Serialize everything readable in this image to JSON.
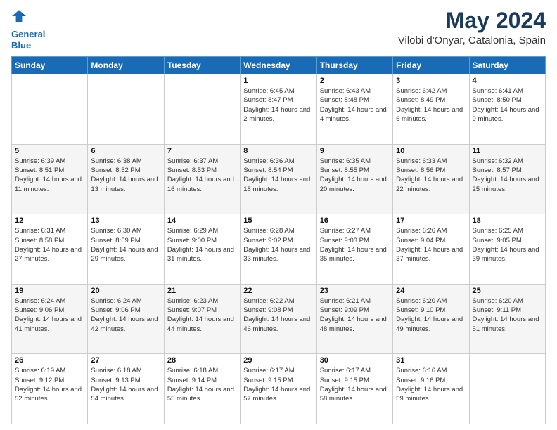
{
  "logo": {
    "line1": "General",
    "line2": "Blue"
  },
  "title": "May 2024",
  "subtitle": "Vilobi d'Onyar, Catalonia, Spain",
  "weekdays": [
    "Sunday",
    "Monday",
    "Tuesday",
    "Wednesday",
    "Thursday",
    "Friday",
    "Saturday"
  ],
  "weeks": [
    [
      {
        "day": "",
        "sunrise": "",
        "sunset": "",
        "daylight": ""
      },
      {
        "day": "",
        "sunrise": "",
        "sunset": "",
        "daylight": ""
      },
      {
        "day": "",
        "sunrise": "",
        "sunset": "",
        "daylight": ""
      },
      {
        "day": "1",
        "sunrise": "Sunrise: 6:45 AM",
        "sunset": "Sunset: 8:47 PM",
        "daylight": "Daylight: 14 hours and 2 minutes."
      },
      {
        "day": "2",
        "sunrise": "Sunrise: 6:43 AM",
        "sunset": "Sunset: 8:48 PM",
        "daylight": "Daylight: 14 hours and 4 minutes."
      },
      {
        "day": "3",
        "sunrise": "Sunrise: 6:42 AM",
        "sunset": "Sunset: 8:49 PM",
        "daylight": "Daylight: 14 hours and 6 minutes."
      },
      {
        "day": "4",
        "sunrise": "Sunrise: 6:41 AM",
        "sunset": "Sunset: 8:50 PM",
        "daylight": "Daylight: 14 hours and 9 minutes."
      }
    ],
    [
      {
        "day": "5",
        "sunrise": "Sunrise: 6:39 AM",
        "sunset": "Sunset: 8:51 PM",
        "daylight": "Daylight: 14 hours and 11 minutes."
      },
      {
        "day": "6",
        "sunrise": "Sunrise: 6:38 AM",
        "sunset": "Sunset: 8:52 PM",
        "daylight": "Daylight: 14 hours and 13 minutes."
      },
      {
        "day": "7",
        "sunrise": "Sunrise: 6:37 AM",
        "sunset": "Sunset: 8:53 PM",
        "daylight": "Daylight: 14 hours and 16 minutes."
      },
      {
        "day": "8",
        "sunrise": "Sunrise: 6:36 AM",
        "sunset": "Sunset: 8:54 PM",
        "daylight": "Daylight: 14 hours and 18 minutes."
      },
      {
        "day": "9",
        "sunrise": "Sunrise: 6:35 AM",
        "sunset": "Sunset: 8:55 PM",
        "daylight": "Daylight: 14 hours and 20 minutes."
      },
      {
        "day": "10",
        "sunrise": "Sunrise: 6:33 AM",
        "sunset": "Sunset: 8:56 PM",
        "daylight": "Daylight: 14 hours and 22 minutes."
      },
      {
        "day": "11",
        "sunrise": "Sunrise: 6:32 AM",
        "sunset": "Sunset: 8:57 PM",
        "daylight": "Daylight: 14 hours and 25 minutes."
      }
    ],
    [
      {
        "day": "12",
        "sunrise": "Sunrise: 6:31 AM",
        "sunset": "Sunset: 8:58 PM",
        "daylight": "Daylight: 14 hours and 27 minutes."
      },
      {
        "day": "13",
        "sunrise": "Sunrise: 6:30 AM",
        "sunset": "Sunset: 8:59 PM",
        "daylight": "Daylight: 14 hours and 29 minutes."
      },
      {
        "day": "14",
        "sunrise": "Sunrise: 6:29 AM",
        "sunset": "Sunset: 9:00 PM",
        "daylight": "Daylight: 14 hours and 31 minutes."
      },
      {
        "day": "15",
        "sunrise": "Sunrise: 6:28 AM",
        "sunset": "Sunset: 9:02 PM",
        "daylight": "Daylight: 14 hours and 33 minutes."
      },
      {
        "day": "16",
        "sunrise": "Sunrise: 6:27 AM",
        "sunset": "Sunset: 9:03 PM",
        "daylight": "Daylight: 14 hours and 35 minutes."
      },
      {
        "day": "17",
        "sunrise": "Sunrise: 6:26 AM",
        "sunset": "Sunset: 9:04 PM",
        "daylight": "Daylight: 14 hours and 37 minutes."
      },
      {
        "day": "18",
        "sunrise": "Sunrise: 6:25 AM",
        "sunset": "Sunset: 9:05 PM",
        "daylight": "Daylight: 14 hours and 39 minutes."
      }
    ],
    [
      {
        "day": "19",
        "sunrise": "Sunrise: 6:24 AM",
        "sunset": "Sunset: 9:06 PM",
        "daylight": "Daylight: 14 hours and 41 minutes."
      },
      {
        "day": "20",
        "sunrise": "Sunrise: 6:24 AM",
        "sunset": "Sunset: 9:06 PM",
        "daylight": "Daylight: 14 hours and 42 minutes."
      },
      {
        "day": "21",
        "sunrise": "Sunrise: 6:23 AM",
        "sunset": "Sunset: 9:07 PM",
        "daylight": "Daylight: 14 hours and 44 minutes."
      },
      {
        "day": "22",
        "sunrise": "Sunrise: 6:22 AM",
        "sunset": "Sunset: 9:08 PM",
        "daylight": "Daylight: 14 hours and 46 minutes."
      },
      {
        "day": "23",
        "sunrise": "Sunrise: 6:21 AM",
        "sunset": "Sunset: 9:09 PM",
        "daylight": "Daylight: 14 hours and 48 minutes."
      },
      {
        "day": "24",
        "sunrise": "Sunrise: 6:20 AM",
        "sunset": "Sunset: 9:10 PM",
        "daylight": "Daylight: 14 hours and 49 minutes."
      },
      {
        "day": "25",
        "sunrise": "Sunrise: 6:20 AM",
        "sunset": "Sunset: 9:11 PM",
        "daylight": "Daylight: 14 hours and 51 minutes."
      }
    ],
    [
      {
        "day": "26",
        "sunrise": "Sunrise: 6:19 AM",
        "sunset": "Sunset: 9:12 PM",
        "daylight": "Daylight: 14 hours and 52 minutes."
      },
      {
        "day": "27",
        "sunrise": "Sunrise: 6:18 AM",
        "sunset": "Sunset: 9:13 PM",
        "daylight": "Daylight: 14 hours and 54 minutes."
      },
      {
        "day": "28",
        "sunrise": "Sunrise: 6:18 AM",
        "sunset": "Sunset: 9:14 PM",
        "daylight": "Daylight: 14 hours and 55 minutes."
      },
      {
        "day": "29",
        "sunrise": "Sunrise: 6:17 AM",
        "sunset": "Sunset: 9:15 PM",
        "daylight": "Daylight: 14 hours and 57 minutes."
      },
      {
        "day": "30",
        "sunrise": "Sunrise: 6:17 AM",
        "sunset": "Sunset: 9:15 PM",
        "daylight": "Daylight: 14 hours and 58 minutes."
      },
      {
        "day": "31",
        "sunrise": "Sunrise: 6:16 AM",
        "sunset": "Sunset: 9:16 PM",
        "daylight": "Daylight: 14 hours and 59 minutes."
      },
      {
        "day": "",
        "sunrise": "",
        "sunset": "",
        "daylight": ""
      }
    ]
  ]
}
